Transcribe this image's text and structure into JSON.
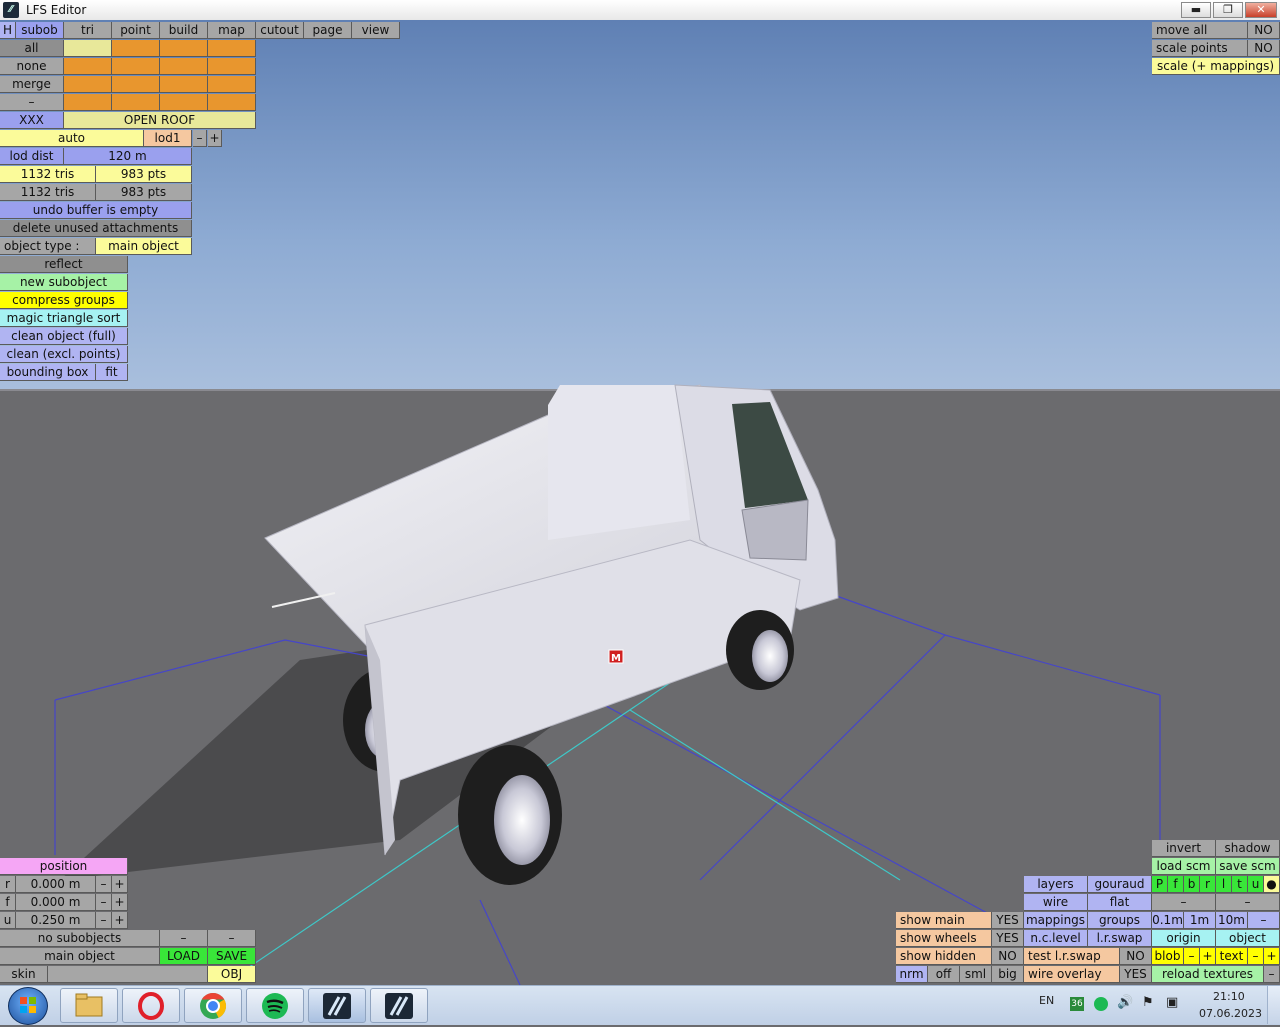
{
  "window": {
    "title": "LFS Editor",
    "minimize": "▬",
    "restore": "❐",
    "close": "✕"
  },
  "menu": {
    "h": "H",
    "items": [
      "subob",
      "tri",
      "point",
      "build",
      "map",
      "cutout",
      "page",
      "view"
    ]
  },
  "left": {
    "filters": [
      "all",
      "none",
      "merge",
      "–"
    ],
    "xxx": "XXX",
    "open_roof": "OPEN ROOF",
    "auto": "auto",
    "lod": "lod1",
    "minus": "–",
    "plus": "+",
    "lod_dist_label": "lod dist",
    "lod_dist_value": "120 m",
    "tris1": "1132 tris",
    "pts1": "983 pts",
    "tris2": "1132 tris",
    "pts2": "983 pts",
    "undo": "undo buffer is empty",
    "delete_unused": "delete unused attachments",
    "object_type_label": "object type :",
    "object_type_value": "main object",
    "reflect": "reflect",
    "new_subobject": "new subobject",
    "compress_groups": "compress groups",
    "magic_sort": "magic triangle sort",
    "clean_full": "clean object (full)",
    "clean_excl": "clean (excl. points)",
    "bounding_box": "bounding box",
    "fit": "fit"
  },
  "topright": {
    "move_all": "move all",
    "move_all_val": "NO",
    "scale_points": "scale points",
    "scale_points_val": "NO",
    "scale_mappings": "scale (+ mappings)"
  },
  "position": {
    "title": "position",
    "rows": [
      {
        "axis": "r",
        "value": "0.000 m"
      },
      {
        "axis": "f",
        "value": "0.000 m"
      },
      {
        "axis": "u",
        "value": "0.250 m"
      }
    ],
    "minus": "–",
    "plus": "+",
    "no_subobjects": "no subobjects",
    "main_object": "main object",
    "load": "LOAD",
    "save": "SAVE",
    "skin": "skin",
    "obj": "OBJ"
  },
  "bottomright": {
    "invert": "invert",
    "shadow": "shadow",
    "load_scm": "load scm",
    "save_scm": "save scm",
    "channels": [
      "P",
      "f",
      "b",
      "r",
      "l",
      "t",
      "u",
      "●"
    ],
    "layers": "layers",
    "gouraud": "gouraud",
    "wire": "wire",
    "flat": "flat",
    "dash": "–",
    "show_main": "show main",
    "show_main_val": "YES",
    "mappings": "mappings",
    "groups": "groups",
    "d01": "0.1m",
    "d1": "1m",
    "d10": "10m",
    "dminus": "–",
    "show_wheels": "show wheels",
    "show_wheels_val": "YES",
    "nclevel": "n.c.level",
    "lrswap": "l.r.swap",
    "origin": "origin",
    "object": "object",
    "show_hidden": "show hidden",
    "show_hidden_val": "NO",
    "test_lrswap": "test l.r.swap",
    "test_lrswap_val": "NO",
    "blob": "blob",
    "text": "text",
    "nrm": "nrm",
    "off": "off",
    "sml": "sml",
    "big": "big",
    "wire_overlay": "wire overlay",
    "wire_overlay_val": "YES",
    "reload_textures": "reload textures",
    "minus": "–",
    "plus": "+"
  },
  "taskbar": {
    "lang": "EN",
    "badge": "36",
    "time": "21:10",
    "date": "07.06.2023"
  },
  "viewport": {
    "marker": "M"
  }
}
